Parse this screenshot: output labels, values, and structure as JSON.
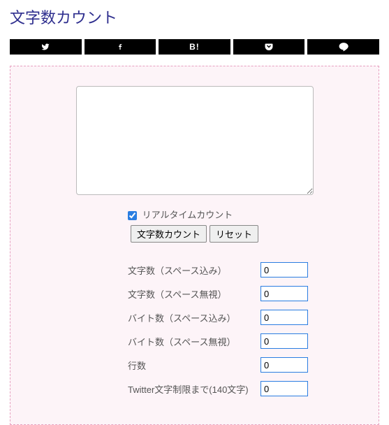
{
  "title": "文字数カウント",
  "share": {
    "twitter": "twitter",
    "facebook": "facebook",
    "hatena_label": "B!",
    "pocket": "pocket",
    "line": "line"
  },
  "textarea": {
    "value": "",
    "placeholder": ""
  },
  "realtime": {
    "checked": true,
    "label": "リアルタイムカウント"
  },
  "buttons": {
    "count": "文字数カウント",
    "reset": "リセット"
  },
  "results": [
    {
      "label": "文字数（スペース込み）",
      "value": "0"
    },
    {
      "label": "文字数（スペース無視）",
      "value": "0"
    },
    {
      "label": "バイト数（スペース込み）",
      "value": "0"
    },
    {
      "label": "バイト数（スペース無視）",
      "value": "0"
    },
    {
      "label": "行数",
      "value": "0"
    },
    {
      "label": "Twitter文字制限まで(140文字)",
      "value": "0"
    }
  ]
}
